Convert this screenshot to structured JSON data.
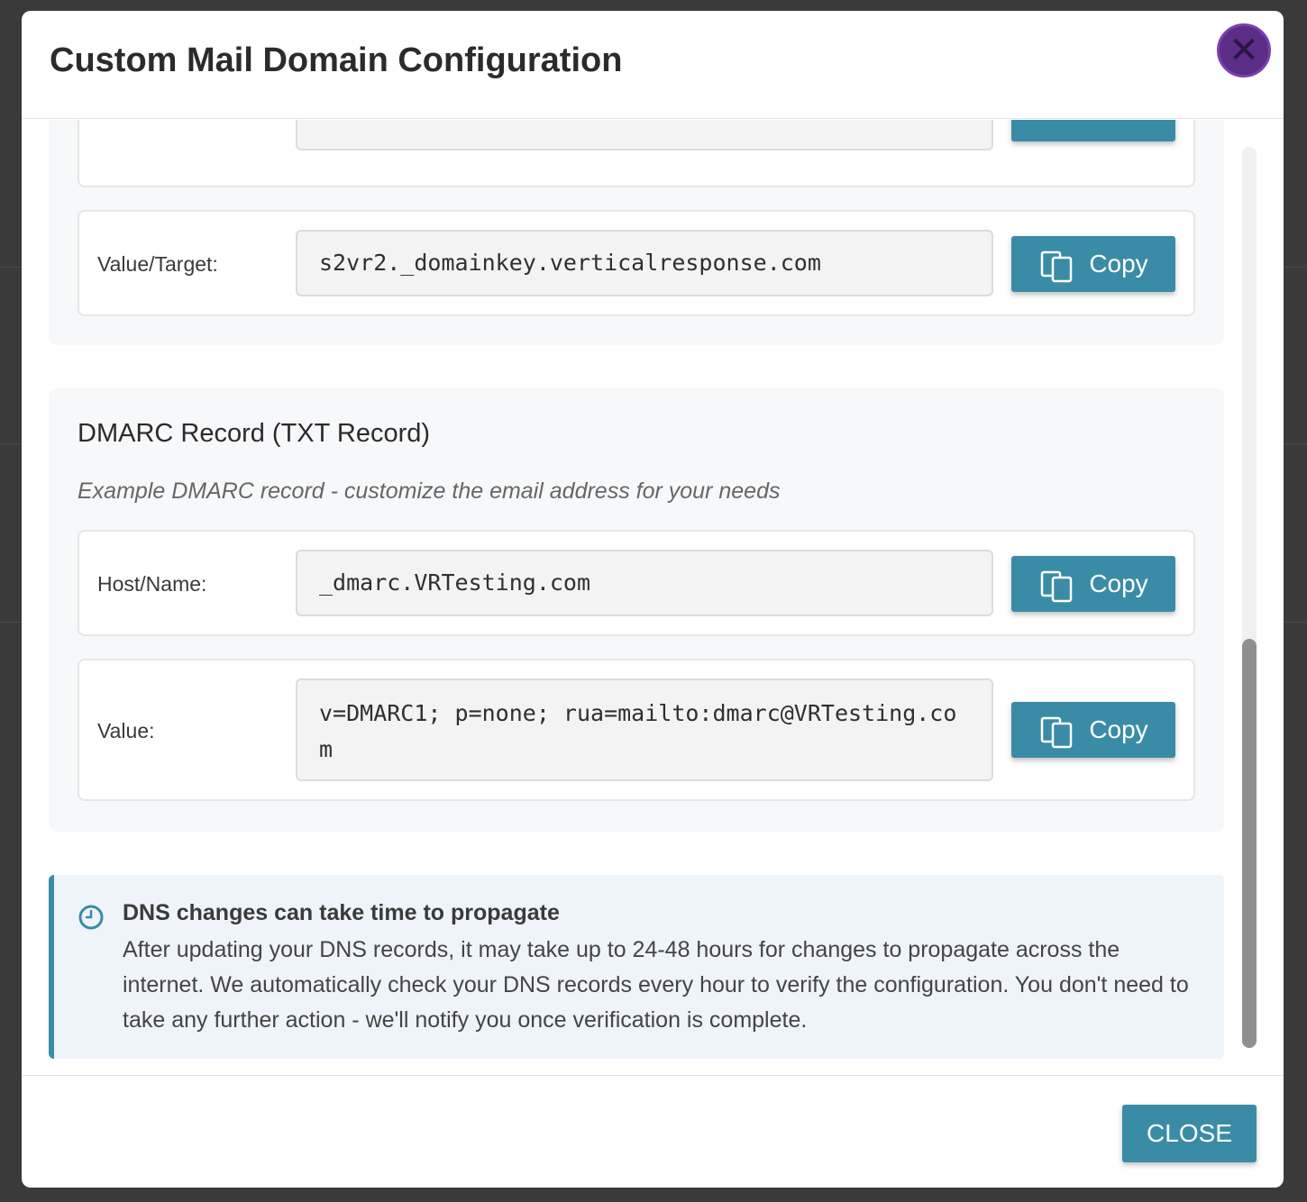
{
  "modal": {
    "title": "Custom Mail Domain Configuration"
  },
  "dkim": {
    "value_label": "Value/Target:",
    "value": "s2vr2._domainkey.verticalresponse.com"
  },
  "dmarc": {
    "title": "DMARC Record (TXT Record)",
    "subtitle": "Example DMARC record - customize the email address for your needs",
    "host_label": "Host/Name:",
    "host_value": "_dmarc.VRTesting.com",
    "value_label": "Value:",
    "value": "v=DMARC1; p=none; rua=mailto:dmarc@VRTesting.com"
  },
  "copy_label": "Copy",
  "info": {
    "title": "DNS changes can take time to propagate",
    "text": "After updating your DNS records, it may take up to 24-48 hours for changes to propagate across the internet. We automatically check your DNS records every hour to verify the configuration. You don't need to take any further action - we'll notify you once verification is complete."
  },
  "footer": {
    "close_label": "CLOSE"
  },
  "colors": {
    "accent": "#3a8ca6",
    "close_icon": "#5b2d86",
    "info_bg": "#eef4fa"
  },
  "icons": {
    "copy": "copy-icon",
    "clock": "clock-icon",
    "close": "close-icon"
  }
}
